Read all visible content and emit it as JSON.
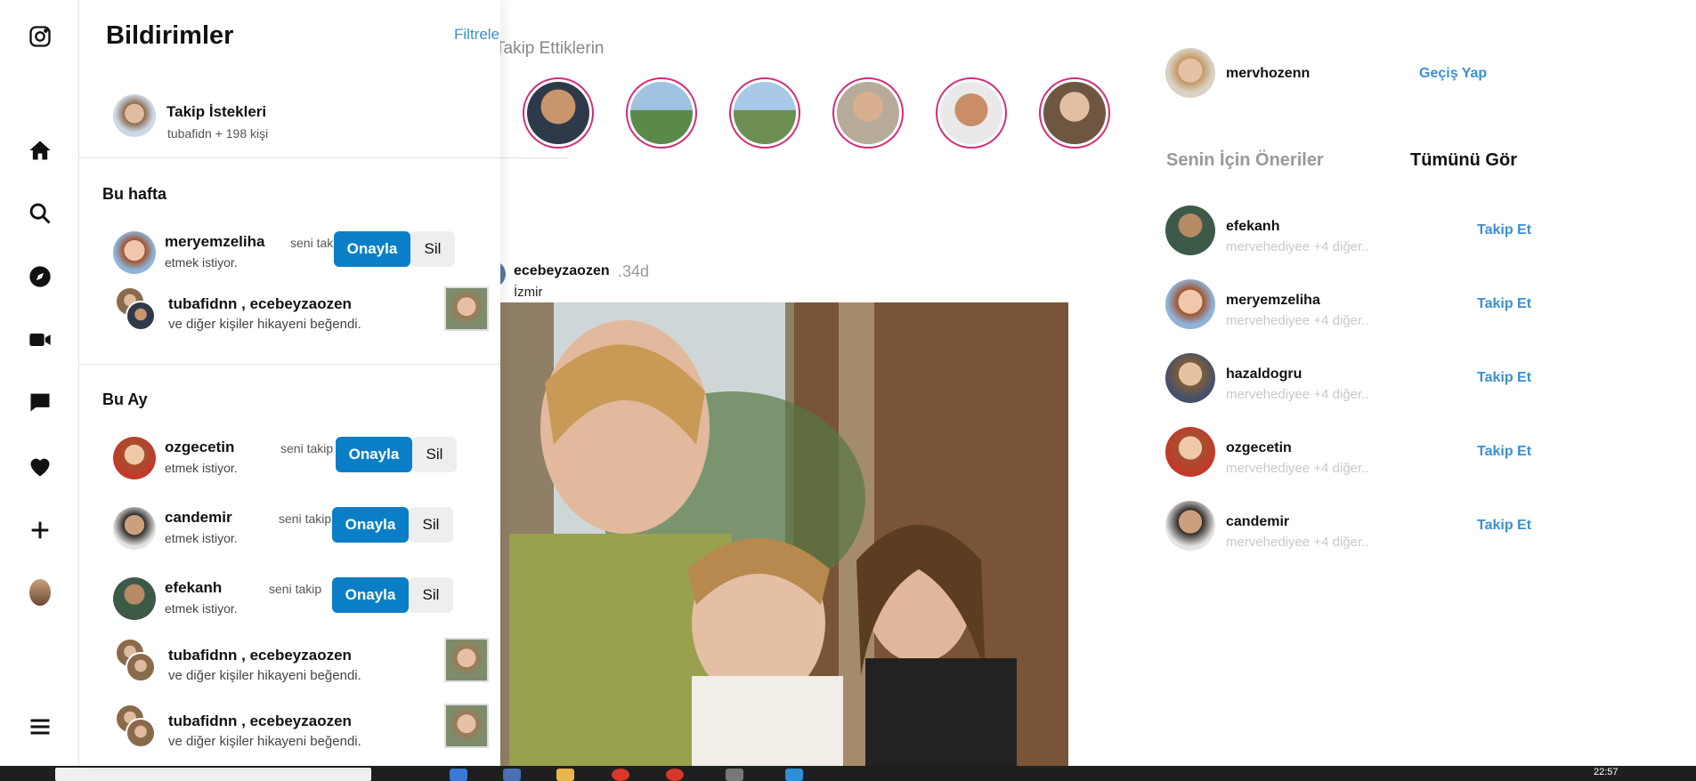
{
  "panel": {
    "title": "Bildirimler",
    "filter_label": "Filtrele",
    "follow_requests": {
      "title": "Takip İstekleri",
      "subtitle": "tubafidn + 198 kişi"
    },
    "week_label": "Bu hafta",
    "month_label": "Bu Ay",
    "approve_label": "Onayla",
    "delete_label": "Sil",
    "request_action_1": "seni takip",
    "request_action_2": "etmek istiyor.",
    "like_names": "tubafidnn , ecebeyzaozen",
    "like_text": "ve diğer kişiler hikayeni beğendi.",
    "week_requests": [
      {
        "username": "meryemzeliha"
      }
    ],
    "month_requests": [
      {
        "username": "ozgecetin"
      },
      {
        "username": "candemir"
      },
      {
        "username": "efekanh"
      }
    ]
  },
  "feed": {
    "stories_label": "Takip Ettiklerin",
    "post": {
      "username": "ecebeyzaozen",
      "time": ".34d",
      "location": "İzmir"
    }
  },
  "sidebar": {
    "me": {
      "username": "mervhozenn",
      "switch_label": "Geçiş Yap"
    },
    "suggestions_title": "Senin İçin Öneriler",
    "see_all_label": "Tümünü Gör",
    "follow_label": "Takip Et",
    "suggestion_sub": "mervehediyee +4 diğer..",
    "suggestions": [
      {
        "username": "efekanh"
      },
      {
        "username": "meryemzeliha"
      },
      {
        "username": "hazaldogru"
      },
      {
        "username": "ozgecetin"
      },
      {
        "username": "candemir"
      }
    ]
  },
  "taskbar": {
    "time": "22:57"
  },
  "colors": {
    "accent": "#0a7fc8",
    "link": "#3b8fd6",
    "story_ring": "#d62976"
  }
}
